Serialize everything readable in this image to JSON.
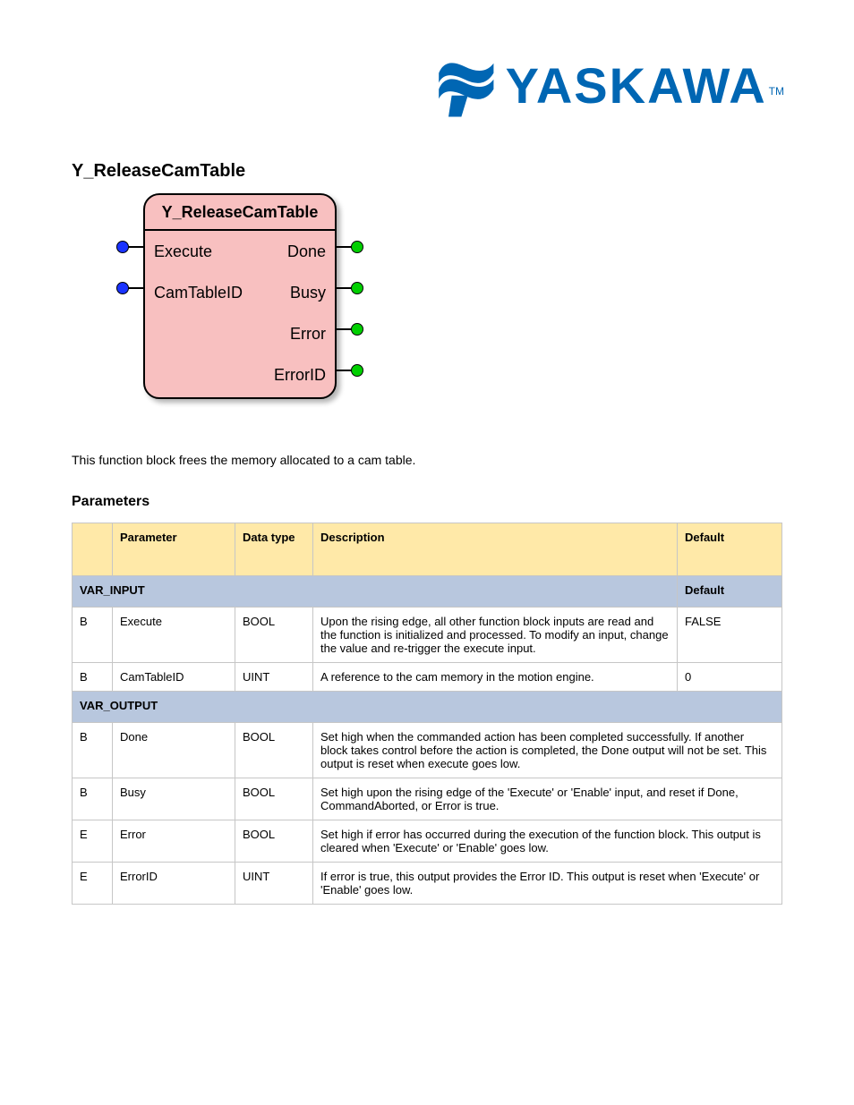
{
  "logo": {
    "brand": "YASKAWA",
    "tm": "TM"
  },
  "headings": {
    "title": "Y_ReleaseCamTable",
    "parameters": "Parameters"
  },
  "fblock": {
    "title": "Y_ReleaseCamTable",
    "inputs": [
      "Execute",
      "CamTableID"
    ],
    "outputs": [
      "Done",
      "Busy",
      "Error",
      "ErrorID"
    ]
  },
  "intro": "This function block frees the memory allocated to a cam table.",
  "table": {
    "headers": {
      "parameter": "Parameter",
      "datatype": "Data type",
      "description": "Description",
      "default": "Default"
    },
    "sections": {
      "var_input": "VAR_INPUT",
      "var_output": "VAR_OUTPUT"
    },
    "rows_input": [
      {
        "io": "B",
        "param": "Execute",
        "type": "BOOL",
        "desc": "Upon the rising edge, all other function block inputs are read and the function is initialized and processed. To modify an input, change the value and re-trigger the execute input.",
        "default": "FALSE"
      },
      {
        "io": "B",
        "param": "CamTableID",
        "type": "UINT",
        "desc": "A reference to the cam memory in the motion engine.",
        "default": "0"
      }
    ],
    "rows_output": [
      {
        "io": "B",
        "param": "Done",
        "type": "BOOL",
        "desc": "Set high when the commanded action has been completed successfully. If another block takes control before the action is completed, the Done output will not be set. This output is reset when execute goes low."
      },
      {
        "io": "B",
        "param": "Busy",
        "type": "BOOL",
        "desc": "Set high upon the rising edge of the 'Execute' or 'Enable' input, and reset if Done, CommandAborted, or Error is true."
      },
      {
        "io": "E",
        "param": "Error",
        "type": "BOOL",
        "desc": "Set high if error has occurred during the execution of the function block. This output is cleared when 'Execute' or 'Enable' goes low."
      },
      {
        "io": "E",
        "param": "ErrorID",
        "type": "UINT",
        "desc": "If error is true, this output provides the Error ID. This output is reset when 'Execute' or 'Enable' goes low."
      }
    ]
  }
}
